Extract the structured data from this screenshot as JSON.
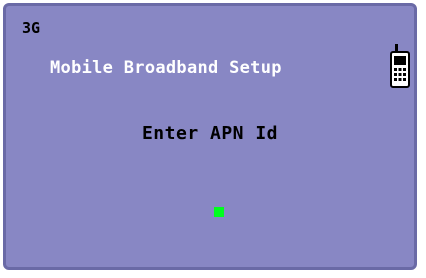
{
  "status": {
    "network": "3G"
  },
  "header": {
    "title": "Mobile Broadband Setup",
    "device_icon": "mobile-phone-icon"
  },
  "main": {
    "prompt": "Enter APN Id",
    "apn_value": ""
  },
  "colors": {
    "background": "#8887c4",
    "border": "#6a6aa6",
    "title_text": "#ffffff",
    "body_text": "#000000",
    "cursor": "#00ff1e"
  }
}
